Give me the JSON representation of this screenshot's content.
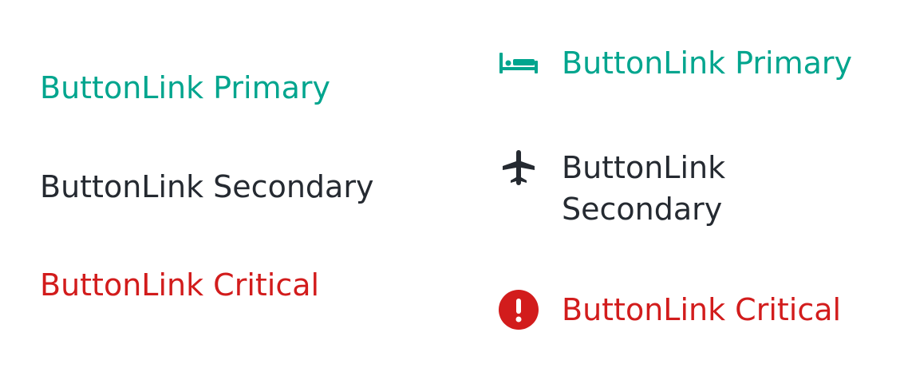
{
  "buttons_text_only": {
    "primary_label": "ButtonLink Primary",
    "secondary_label": "ButtonLink Secondary",
    "critical_label": "ButtonLink Critical"
  },
  "buttons_with_icon": {
    "primary": {
      "label": "ButtonLink Primary",
      "icon": "bed-icon"
    },
    "secondary": {
      "label": "ButtonLink Secondary",
      "icon": "airplane-icon"
    },
    "critical": {
      "label": "ButtonLink Critical",
      "icon": "alert-circle-icon"
    }
  },
  "colors": {
    "primary": "#00a58e",
    "secondary": "#252a31",
    "critical": "#d21c1c"
  }
}
